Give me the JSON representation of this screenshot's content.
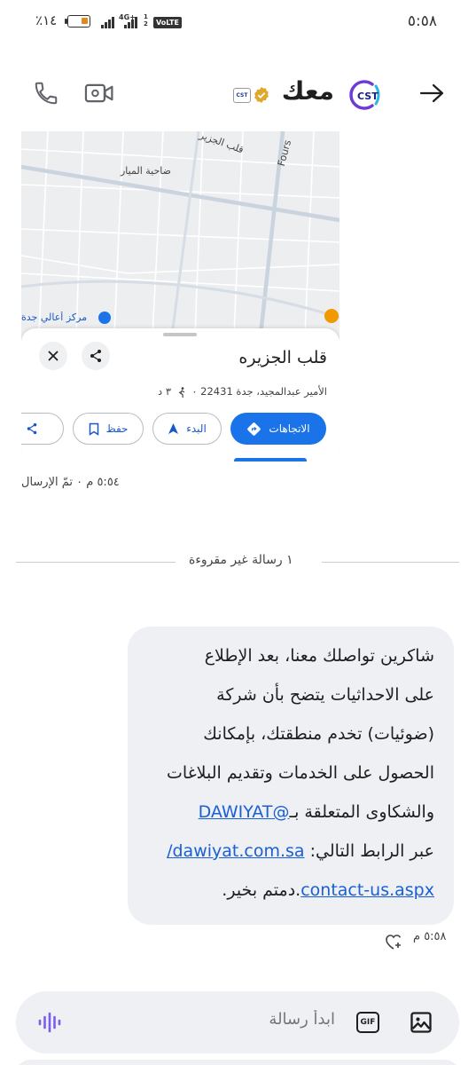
{
  "status_bar": {
    "time": "٥:٥٨",
    "battery_percent": "٪١٤",
    "network_label": "4G+",
    "sim_slots": "1 2",
    "volte_label": "VoLTE"
  },
  "header": {
    "contact_name": "معك",
    "small_logo_text": "CST",
    "cst_logo_text": "CST"
  },
  "map_card": {
    "map_labels": {
      "road_1": "قلب الجزير",
      "road_2": "Fours",
      "district": "ضاحية الميار",
      "poi": "مركز أعالي جدة"
    },
    "place_title": "قلب الجزيره",
    "address": "الأمير عبدالمجيد، جدة 22431 ٠",
    "walk_time": "٣ د",
    "chips": {
      "directions": "الاتجاهات",
      "start": "البدء",
      "save": "حفظ",
      "share": "مش"
    }
  },
  "sent_status": "٥:٥٤ م ٠ تمّ الإرسال",
  "unread_divider": "١ رسالة غير مقروءة",
  "message": {
    "line1": "شاكرين تواصلك معنا، بعد الإطلاع",
    "line2": "على الاحداثيات يتضح بأن شركة",
    "line3": "(ضوئيات) تخدم منطقتك، بإمكانك",
    "line4": "الحصول على الخدمات وتقديم البلاغات",
    "line5_text": "والشكاوى المتعلقة بـ",
    "line5_link": "@DAWIYAT",
    "line6_text": "عبر الرابط التالي: ",
    "line6_link": "dawiyat.com.sa/",
    "line7_link": "contact-us.aspx",
    "line7_text": ".دمتم بخير.",
    "time": "٥:٥٨ م"
  },
  "compose": {
    "placeholder": "ابدأ رسالة",
    "gif_label": "GIF"
  },
  "colors": {
    "accent_blue": "#1a73e8",
    "bubble_bg": "#eef0f4",
    "voice_icon": "#7b5cf0"
  },
  "icons": [
    "back-arrow-icon",
    "video-call-icon",
    "phone-icon",
    "verified-icon",
    "close-icon",
    "share-icon",
    "directions-icon",
    "navigation-icon",
    "bookmark-icon",
    "walk-icon",
    "react-heart-icon",
    "image-icon",
    "gif-icon",
    "voice-icon"
  ]
}
